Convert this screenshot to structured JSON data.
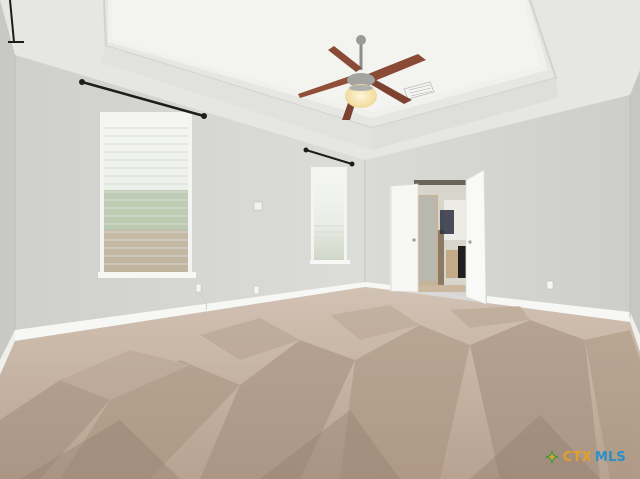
{
  "scene": {
    "subject": "empty-bedroom",
    "colors": {
      "wall": "#d6d7d3",
      "wall_shadow": "#c9cac6",
      "ceiling": "#ebebe8",
      "tray_ceiling": "#f2f2ef",
      "trim": "#f7f7f5",
      "carpet_light": "#c7b3a2",
      "carpet_dark": "#a48f7f",
      "fan_blade": "#8a4a35",
      "fan_metal": "#9a9a98",
      "light_glow": "#f6e3b0",
      "curtain_rod": "#1d1d1d"
    }
  },
  "watermark": {
    "part_a": "CTX",
    "part_b": "MLS"
  }
}
